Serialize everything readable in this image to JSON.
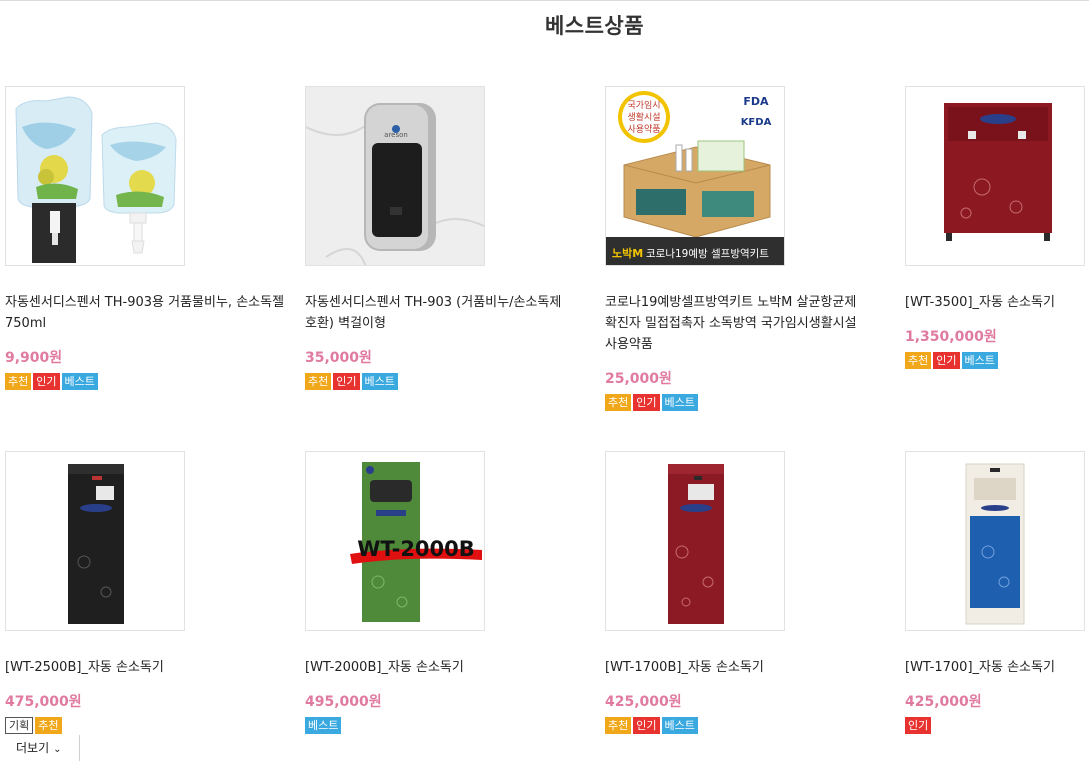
{
  "section_title": "베스트상품",
  "products": [
    {
      "name": "자동센서디스펜서 TH-903용 거품물비누, 손소독젤 750ml",
      "price": "9,900원",
      "badges": [
        "추천",
        "인기",
        "베스트"
      ]
    },
    {
      "name": "자동센서디스펜서 TH-903 (거품비누/손소독제 호환) 벽걸이형",
      "price": "35,000원",
      "badges": [
        "추천",
        "인기",
        "베스트"
      ]
    },
    {
      "name": "코로나19예방셀프방역키트 노박M 살균항균제 확진자 밀접접촉자 소독방역 국가임시생활시설 사용약품",
      "price": "25,000원",
      "badges": [
        "추천",
        "인기",
        "베스트"
      ]
    },
    {
      "name": "[WT-3500]_자동 손소독기",
      "price": "1,350,000원",
      "badges": [
        "추천",
        "인기",
        "베스트"
      ]
    },
    {
      "name": "[WT-2500B]_자동 손소독기",
      "price": "475,000원",
      "badges": [
        "기획",
        "추천"
      ]
    },
    {
      "name": "[WT-2000B]_자동 손소독기",
      "price": "495,000원",
      "badges": [
        "베스트"
      ]
    },
    {
      "name": "[WT-1700B]_자동 손소독기",
      "price": "425,000원",
      "badges": [
        "추천",
        "인기",
        "베스트"
      ]
    },
    {
      "name": "[WT-1700]_자동 손소독기",
      "price": "425,000원",
      "badges": [
        "인기"
      ]
    }
  ],
  "image_text": {
    "p2_brand": "areson",
    "p3_stamp_line1": "국가임시",
    "p3_stamp_line2": "생활시설",
    "p3_stamp_line3": "사용약품",
    "p3_fda": "FDA",
    "p3_kfda": "KFDA",
    "p3_banner_brand": "노박M",
    "p3_banner_text": " 코로나19예방 셀프방역키트",
    "p6_model": "WT-2000B"
  },
  "more_button": {
    "label": "더보기"
  },
  "colors": {
    "price": "#e07aa0",
    "recommend": "#f0a81a",
    "popular": "#e8322f",
    "best": "#3aa9e0"
  }
}
